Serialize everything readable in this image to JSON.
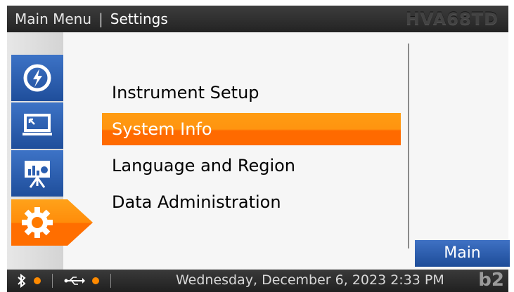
{
  "titlebar": {
    "main_menu": "Main Menu",
    "separator": "|",
    "settings": "Settings",
    "device_name": "HVA68TD"
  },
  "sidebar": {
    "tabs": [
      {
        "icon": "power-icon",
        "active": false
      },
      {
        "icon": "monitor-icon",
        "active": false
      },
      {
        "icon": "presentation-icon",
        "active": false
      },
      {
        "icon": "gear-icon",
        "active": true
      }
    ]
  },
  "menu": {
    "items": [
      {
        "label": "Instrument Setup",
        "selected": false
      },
      {
        "label": "System Info",
        "selected": true
      },
      {
        "label": "Language and Region",
        "selected": false
      },
      {
        "label": "Data Administration",
        "selected": false
      }
    ]
  },
  "main_button": {
    "label": "Main"
  },
  "statusbar": {
    "datetime": "Wednesday, December 6, 2023 2:33 PM",
    "brand": "b2"
  },
  "colors": {
    "accent_orange": "#ff8a00",
    "tab_blue": "#2b5fb0",
    "bar_dark": "#2a2a2a"
  }
}
